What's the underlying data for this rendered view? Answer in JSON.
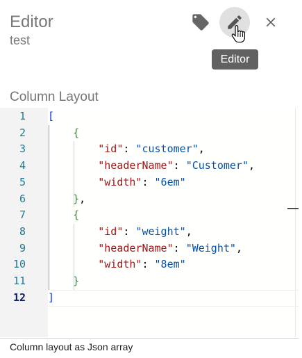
{
  "header": {
    "title": "Editor",
    "subtitle": "test",
    "tooltip": "Editor"
  },
  "toolbar": {
    "icons": [
      "tag-icon",
      "pencil-icon",
      "close-icon"
    ],
    "active": "pencil-icon"
  },
  "field": {
    "label": "Column Layout",
    "helper_text": "Column layout as Json array",
    "current_line": 12
  },
  "code_lines": [
    {
      "num": "1",
      "text": "["
    },
    {
      "num": "2",
      "text": "    {"
    },
    {
      "num": "3",
      "text": "        \"id\": \"customer\","
    },
    {
      "num": "4",
      "text": "        \"headerName\": \"Customer\","
    },
    {
      "num": "5",
      "text": "        \"width\": \"6em\""
    },
    {
      "num": "6",
      "text": "    },"
    },
    {
      "num": "7",
      "text": "    {"
    },
    {
      "num": "8",
      "text": "        \"id\": \"weight\","
    },
    {
      "num": "9",
      "text": "        \"headerName\": \"Weight\","
    },
    {
      "num": "10",
      "text": "        \"width\": \"8em\""
    },
    {
      "num": "11",
      "text": "    }"
    },
    {
      "num": "12",
      "text": "]"
    }
  ],
  "colors": {
    "key": "#a31515",
    "string": "#0451a5",
    "bracket_outer": "#0431fa",
    "bracket_inner": "#319331",
    "line_number": "#237893"
  }
}
